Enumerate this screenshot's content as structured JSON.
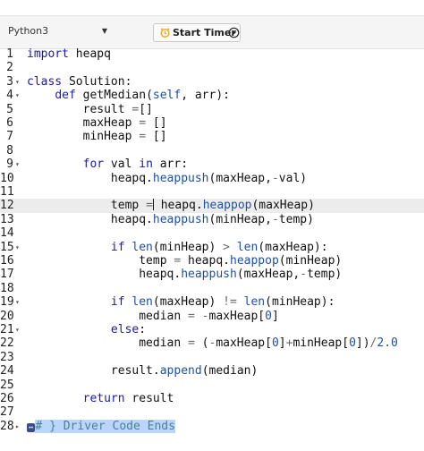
{
  "toolbar": {
    "language": "Python3",
    "timer_label": "Start Timer"
  },
  "editor": {
    "active_line": 12,
    "lines": [
      {
        "n": "1",
        "fold": "",
        "code": [
          {
            "t": "import",
            "c": "kw"
          },
          {
            "t": " heapq",
            "c": ""
          }
        ]
      },
      {
        "n": "2",
        "fold": "",
        "code": []
      },
      {
        "n": "3",
        "fold": "▾",
        "code": [
          {
            "t": "class",
            "c": "kw"
          },
          {
            "t": " Solution:",
            "c": ""
          }
        ]
      },
      {
        "n": "4",
        "fold": "▾",
        "code": [
          {
            "t": "    ",
            "c": ""
          },
          {
            "t": "def",
            "c": "kw"
          },
          {
            "t": " getMedian(",
            "c": ""
          },
          {
            "t": "self",
            "c": "fn"
          },
          {
            "t": ", arr):",
            "c": ""
          }
        ]
      },
      {
        "n": "5",
        "fold": "",
        "code": [
          {
            "t": "        result ",
            "c": ""
          },
          {
            "t": "=",
            "c": "op"
          },
          {
            "t": "[]",
            "c": ""
          }
        ]
      },
      {
        "n": "6",
        "fold": "",
        "code": [
          {
            "t": "        maxHeap ",
            "c": ""
          },
          {
            "t": "=",
            "c": "op"
          },
          {
            "t": " []",
            "c": ""
          }
        ]
      },
      {
        "n": "7",
        "fold": "",
        "code": [
          {
            "t": "        minHeap ",
            "c": ""
          },
          {
            "t": "=",
            "c": "op"
          },
          {
            "t": " []",
            "c": ""
          }
        ]
      },
      {
        "n": "8",
        "fold": "",
        "code": []
      },
      {
        "n": "9",
        "fold": "▾",
        "code": [
          {
            "t": "        ",
            "c": ""
          },
          {
            "t": "for",
            "c": "kw"
          },
          {
            "t": " val ",
            "c": ""
          },
          {
            "t": "in",
            "c": "kw"
          },
          {
            "t": " arr:",
            "c": ""
          }
        ]
      },
      {
        "n": "10",
        "fold": "",
        "code": [
          {
            "t": "            heapq.",
            "c": ""
          },
          {
            "t": "heappush",
            "c": "fn"
          },
          {
            "t": "(maxHeap,",
            "c": ""
          },
          {
            "t": "-",
            "c": "op"
          },
          {
            "t": "val)",
            "c": ""
          }
        ]
      },
      {
        "n": "11",
        "fold": "",
        "code": []
      },
      {
        "n": "12",
        "fold": "",
        "code": [
          {
            "t": "            temp ",
            "c": ""
          },
          {
            "t": "=",
            "c": "op"
          },
          {
            "t": "|",
            "c": "cursor"
          },
          {
            "t": " heapq.",
            "c": ""
          },
          {
            "t": "heappop",
            "c": "fn"
          },
          {
            "t": "(maxHeap)",
            "c": ""
          }
        ]
      },
      {
        "n": "13",
        "fold": "",
        "code": [
          {
            "t": "            heapq.",
            "c": ""
          },
          {
            "t": "heappush",
            "c": "fn"
          },
          {
            "t": "(minHeap,",
            "c": ""
          },
          {
            "t": "-",
            "c": "op"
          },
          {
            "t": "temp)",
            "c": ""
          }
        ]
      },
      {
        "n": "14",
        "fold": "",
        "code": []
      },
      {
        "n": "15",
        "fold": "▾",
        "code": [
          {
            "t": "            ",
            "c": ""
          },
          {
            "t": "if",
            "c": "kw"
          },
          {
            "t": " ",
            "c": ""
          },
          {
            "t": "len",
            "c": "fn"
          },
          {
            "t": "(minHeap) ",
            "c": ""
          },
          {
            "t": ">",
            "c": "op"
          },
          {
            "t": " ",
            "c": ""
          },
          {
            "t": "len",
            "c": "fn"
          },
          {
            "t": "(maxHeap):",
            "c": ""
          }
        ]
      },
      {
        "n": "16",
        "fold": "",
        "code": [
          {
            "t": "                temp ",
            "c": ""
          },
          {
            "t": "=",
            "c": "op"
          },
          {
            "t": " heapq.",
            "c": ""
          },
          {
            "t": "heappop",
            "c": "fn"
          },
          {
            "t": "(minHeap)",
            "c": ""
          }
        ]
      },
      {
        "n": "17",
        "fold": "",
        "code": [
          {
            "t": "                heapq.",
            "c": ""
          },
          {
            "t": "heappush",
            "c": "fn"
          },
          {
            "t": "(maxHeap,",
            "c": ""
          },
          {
            "t": "-",
            "c": "op"
          },
          {
            "t": "temp)",
            "c": ""
          }
        ]
      },
      {
        "n": "18",
        "fold": "",
        "code": []
      },
      {
        "n": "19",
        "fold": "▾",
        "code": [
          {
            "t": "            ",
            "c": ""
          },
          {
            "t": "if",
            "c": "kw"
          },
          {
            "t": " ",
            "c": ""
          },
          {
            "t": "len",
            "c": "fn"
          },
          {
            "t": "(maxHeap) ",
            "c": ""
          },
          {
            "t": "!=",
            "c": "op"
          },
          {
            "t": " ",
            "c": ""
          },
          {
            "t": "len",
            "c": "fn"
          },
          {
            "t": "(minHeap):",
            "c": ""
          }
        ]
      },
      {
        "n": "20",
        "fold": "",
        "code": [
          {
            "t": "                median ",
            "c": ""
          },
          {
            "t": "=",
            "c": "op"
          },
          {
            "t": " ",
            "c": ""
          },
          {
            "t": "-",
            "c": "op"
          },
          {
            "t": "maxHeap[",
            "c": ""
          },
          {
            "t": "0",
            "c": "fn"
          },
          {
            "t": "]",
            "c": ""
          }
        ]
      },
      {
        "n": "21",
        "fold": "▾",
        "code": [
          {
            "t": "            ",
            "c": ""
          },
          {
            "t": "else",
            "c": "kw"
          },
          {
            "t": ":",
            "c": ""
          }
        ]
      },
      {
        "n": "22",
        "fold": "",
        "code": [
          {
            "t": "                median ",
            "c": ""
          },
          {
            "t": "=",
            "c": "op"
          },
          {
            "t": " (",
            "c": ""
          },
          {
            "t": "-",
            "c": "op"
          },
          {
            "t": "maxHeap[",
            "c": ""
          },
          {
            "t": "0",
            "c": "fn"
          },
          {
            "t": "]",
            "c": ""
          },
          {
            "t": "+",
            "c": "op"
          },
          {
            "t": "minHeap[",
            "c": ""
          },
          {
            "t": "0",
            "c": "fn"
          },
          {
            "t": "])",
            "c": ""
          },
          {
            "t": "/",
            "c": "op"
          },
          {
            "t": "2.0",
            "c": "fn"
          }
        ]
      },
      {
        "n": "23",
        "fold": "",
        "code": []
      },
      {
        "n": "24",
        "fold": "",
        "code": [
          {
            "t": "            result.",
            "c": ""
          },
          {
            "t": "append",
            "c": "fn"
          },
          {
            "t": "(median)",
            "c": ""
          }
        ]
      },
      {
        "n": "25",
        "fold": "",
        "code": []
      },
      {
        "n": "26",
        "fold": "",
        "code": [
          {
            "t": "        ",
            "c": ""
          },
          {
            "t": "return",
            "c": "kw"
          },
          {
            "t": " result",
            "c": ""
          }
        ]
      },
      {
        "n": "27",
        "fold": "",
        "code": []
      },
      {
        "n": "28",
        "fold": "▸",
        "code": [
          {
            "t": "↔",
            "c": "foldbox"
          },
          {
            "t": "# } Driver Code Ends",
            "c": "cmhl"
          }
        ]
      }
    ]
  }
}
